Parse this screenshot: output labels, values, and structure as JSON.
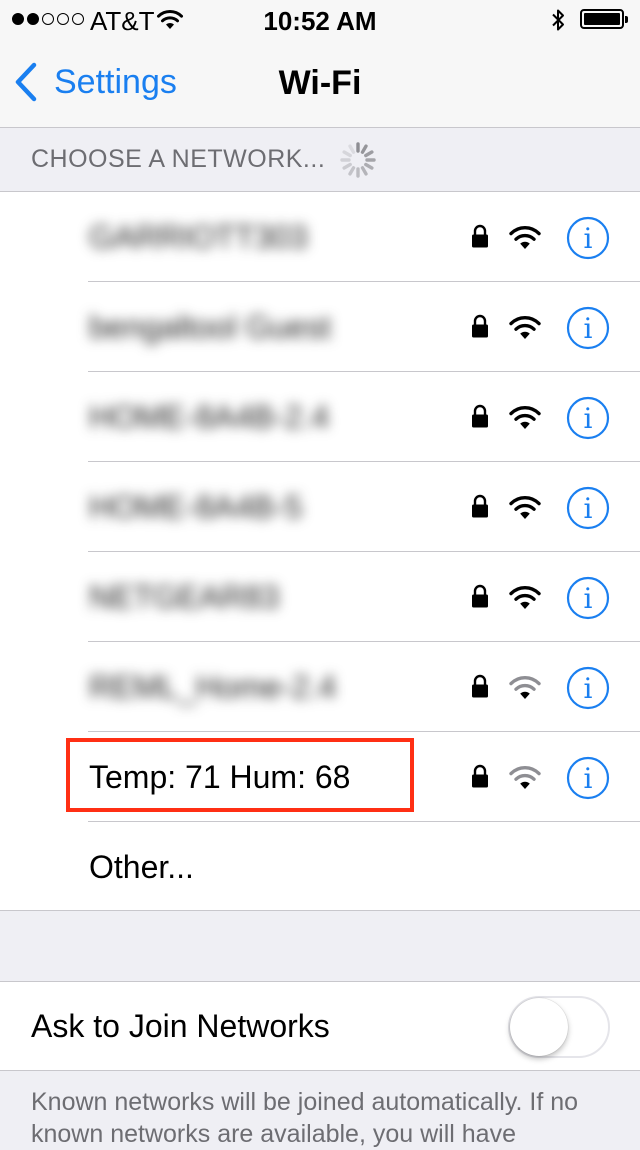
{
  "status_bar": {
    "carrier": "AT&T",
    "time": "10:52 AM",
    "signal_bars_filled": 2,
    "signal_bars_total": 5
  },
  "nav": {
    "back_label": "Settings",
    "title": "Wi-Fi"
  },
  "section_header": "CHOOSE A NETWORK...",
  "networks": [
    {
      "name": "GARRIOTT303",
      "blurred": true,
      "secured": true,
      "signal": "full"
    },
    {
      "name": "bengaltool Guest",
      "blurred": true,
      "secured": true,
      "signal": "full"
    },
    {
      "name": "HOME-8A4B-2.4",
      "blurred": true,
      "secured": true,
      "signal": "full"
    },
    {
      "name": "HOME-8A4B-5",
      "blurred": true,
      "secured": true,
      "signal": "full"
    },
    {
      "name": "NETGEAR83",
      "blurred": true,
      "secured": true,
      "signal": "full"
    },
    {
      "name": "REML_Home-2.4",
      "blurred": true,
      "secured": true,
      "signal": "medium"
    },
    {
      "name": "Temp: 71  Hum: 68",
      "blurred": false,
      "secured": true,
      "signal": "medium",
      "highlighted": true
    }
  ],
  "other_label": "Other...",
  "ask_to_join": {
    "label": "Ask to Join Networks",
    "enabled": false
  },
  "footer_text": "Known networks will be joined automatically. If no known networks are available, you will have",
  "colors": {
    "accent": "#1a7ff0",
    "highlight_border": "#ff2f14",
    "background": "#efeff4"
  },
  "icons": {
    "back": "chevron-left-icon",
    "lock": "lock-icon",
    "wifi": "wifi-icon",
    "info": "info-icon",
    "spinner": "spinner-icon",
    "bluetooth": "bluetooth-icon",
    "battery": "battery-icon"
  }
}
